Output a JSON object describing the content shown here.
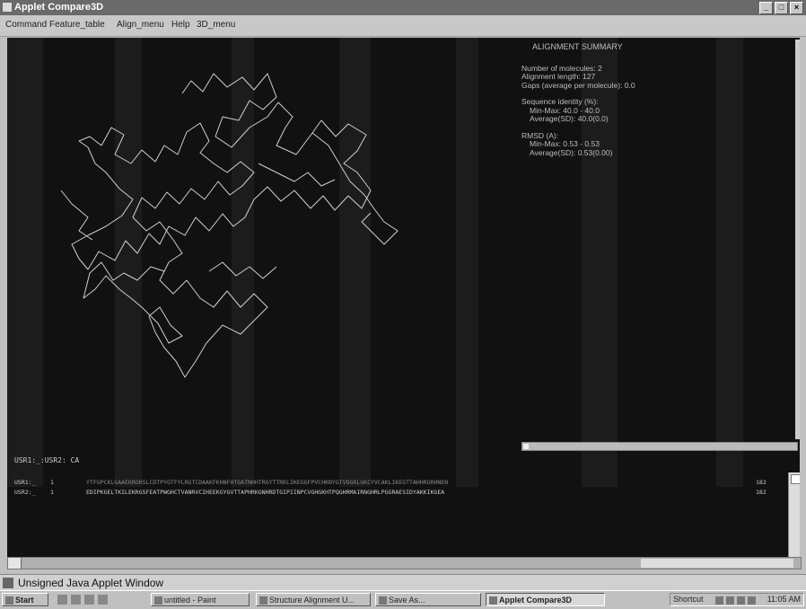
{
  "window": {
    "title": "Applet Compare3D",
    "controls": [
      "minimize-icon",
      "maximize-icon",
      "close-icon"
    ]
  },
  "menu": [
    "Command",
    "Feature_table",
    "Align_menu",
    "Help",
    "3D_menu"
  ],
  "summary": {
    "heading": "ALIGNMENT SUMMARY",
    "molecules": "Number of molecules: 2",
    "length": "Alignment length: 127",
    "gaps": "Gaps (average per molecule): 0.0",
    "identity_label": "Sequence identity (%):",
    "identity_minmax": "Min-Max: 40.0 - 40.0",
    "identity_avg": "Average(SD): 40.0(0.0)",
    "rmsd_label": "RMSD (A):",
    "rmsd_minmax": "Min-Max: 0.53 - 0.53",
    "rmsd_avg": "Average(SD): 0.53(0.00)"
  },
  "sequence": {
    "title": "USR1:_:USR2: CA",
    "rows": [
      {
        "name": "USR1:_",
        "start": "1",
        "seq": "YTFGPCKLGAAEKRGRSLCDTPYGTFYLRGTCDAAKFKHNFHTGATNHHTRGYTTRKLIKEGGFPVCHKNYGTVDGRLGKCYVCAKLIKEGTTAHHRGRHNEN",
        "end": "182"
      },
      {
        "name": "USR2:_",
        "start": "1",
        "seq": "EDIPKGELTKILEKRGSFEATPWGHCTVANRVCIHEEKGYGVTTAPHRKGNHRDTGIPIINPCVGHGKHTPQGHRMAIRNGHRLPGGRAESIDYAKKIKGEA",
        "end": "182"
      }
    ]
  },
  "statusbar": {
    "text": "Unsigned Java Applet Window"
  },
  "taskbar": {
    "start": "Start",
    "buttons": [
      "untitled - Paint",
      "Structure Alignment U...",
      "Save As...",
      "Applet Compare3D",
      "Shortcut"
    ],
    "clock": "11:05 AM"
  }
}
